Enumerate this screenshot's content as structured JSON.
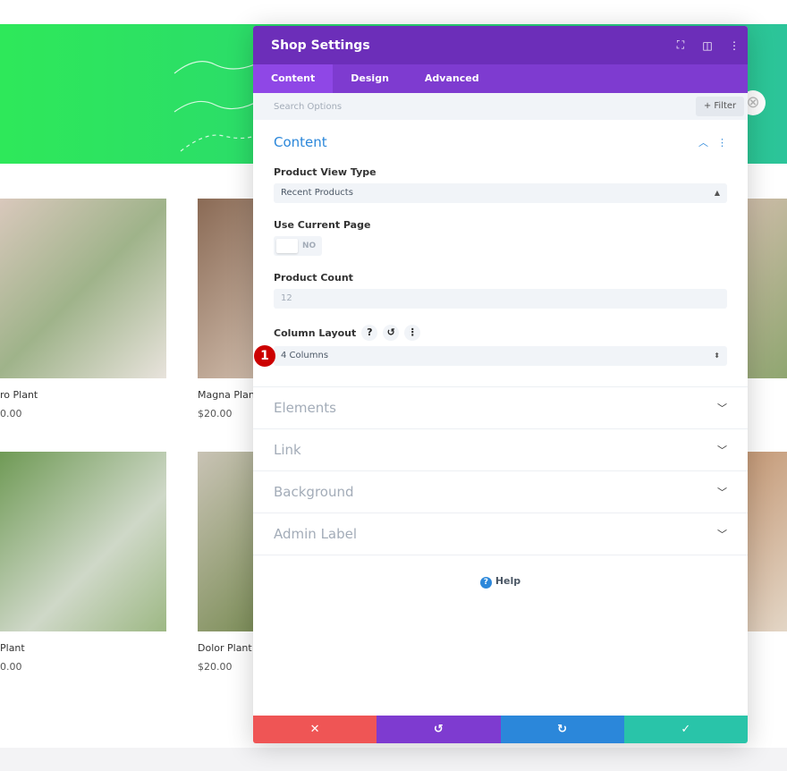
{
  "products": [
    {
      "name": "ro Plant",
      "price": "0.00"
    },
    {
      "name": "Magna Plant",
      "price": "$20.00"
    },
    {
      "name": "Plant",
      "price": "0.00"
    },
    {
      "name": "Dolor Plant",
      "price": "$20.00"
    }
  ],
  "panel": {
    "title": "Shop Settings",
    "tabs": [
      "Content",
      "Design",
      "Advanced"
    ],
    "search_placeholder": "Search Options",
    "filter_label": "+ Filter",
    "section_title": "Content",
    "fields": {
      "view_type_label": "Product View Type",
      "view_type_value": "Recent Products",
      "current_page_label": "Use Current Page",
      "current_page_value": "NO",
      "count_label": "Product Count",
      "count_value": "12",
      "column_label": "Column Layout",
      "column_value": "4 Columns"
    },
    "marker": "1",
    "groups": [
      "Elements",
      "Link",
      "Background",
      "Admin Label"
    ],
    "help": "Help"
  },
  "colors": {
    "header": "#6c2eb9",
    "tabs": "#7e3bd0",
    "cancel": "#ef5555",
    "undo": "#7e3bd0",
    "redo": "#2b87da",
    "save": "#29c4a9"
  }
}
